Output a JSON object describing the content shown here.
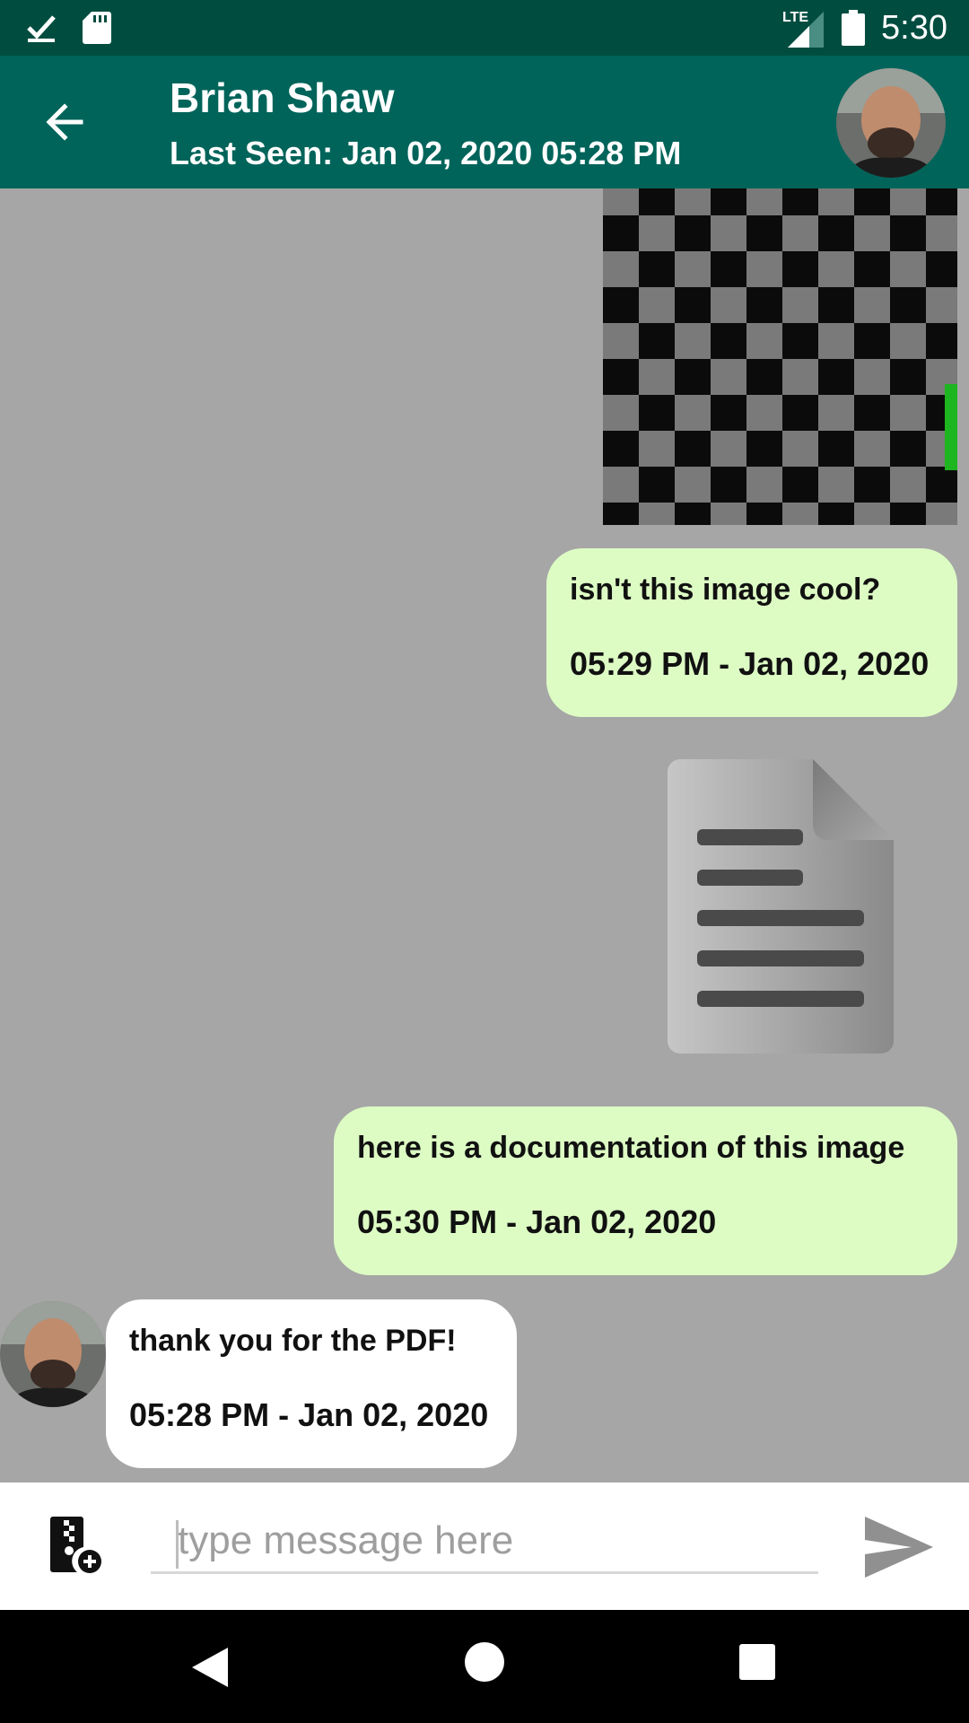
{
  "status_bar": {
    "network": "LTE",
    "time": "5:30",
    "icons": [
      "download-done-icon",
      "sd-card-icon",
      "signal-icon",
      "battery-icon"
    ]
  },
  "header": {
    "back_icon": "arrow-back-icon",
    "contact_name": "Brian Shaw",
    "last_seen": "Last Seen: Jan 02, 2020 05:28 PM",
    "avatar": "contact-avatar"
  },
  "messages": [
    {
      "type": "image",
      "direction": "outgoing"
    },
    {
      "type": "text",
      "direction": "outgoing",
      "text": "isn't this image cool?",
      "time": "05:29 PM - Jan 02, 2020"
    },
    {
      "type": "document",
      "direction": "outgoing",
      "icon": "document-icon"
    },
    {
      "type": "text",
      "direction": "outgoing",
      "text": "here is a documentation of this image",
      "time": "05:30 PM - Jan 02, 2020"
    },
    {
      "type": "text",
      "direction": "incoming",
      "text": "thank you for the PDF!",
      "time": "05:28 PM - Jan 02, 2020"
    }
  ],
  "composer": {
    "placeholder": "type message here",
    "value": "",
    "attach_icon": "attach-file-icon",
    "send_icon": "send-icon"
  },
  "colors": {
    "status_bar": "#004d40",
    "app_bar": "#00645a",
    "chat_background": "#a6a6a6",
    "outgoing_bubble": "#ddfcc4",
    "incoming_bubble": "#ffffff"
  }
}
